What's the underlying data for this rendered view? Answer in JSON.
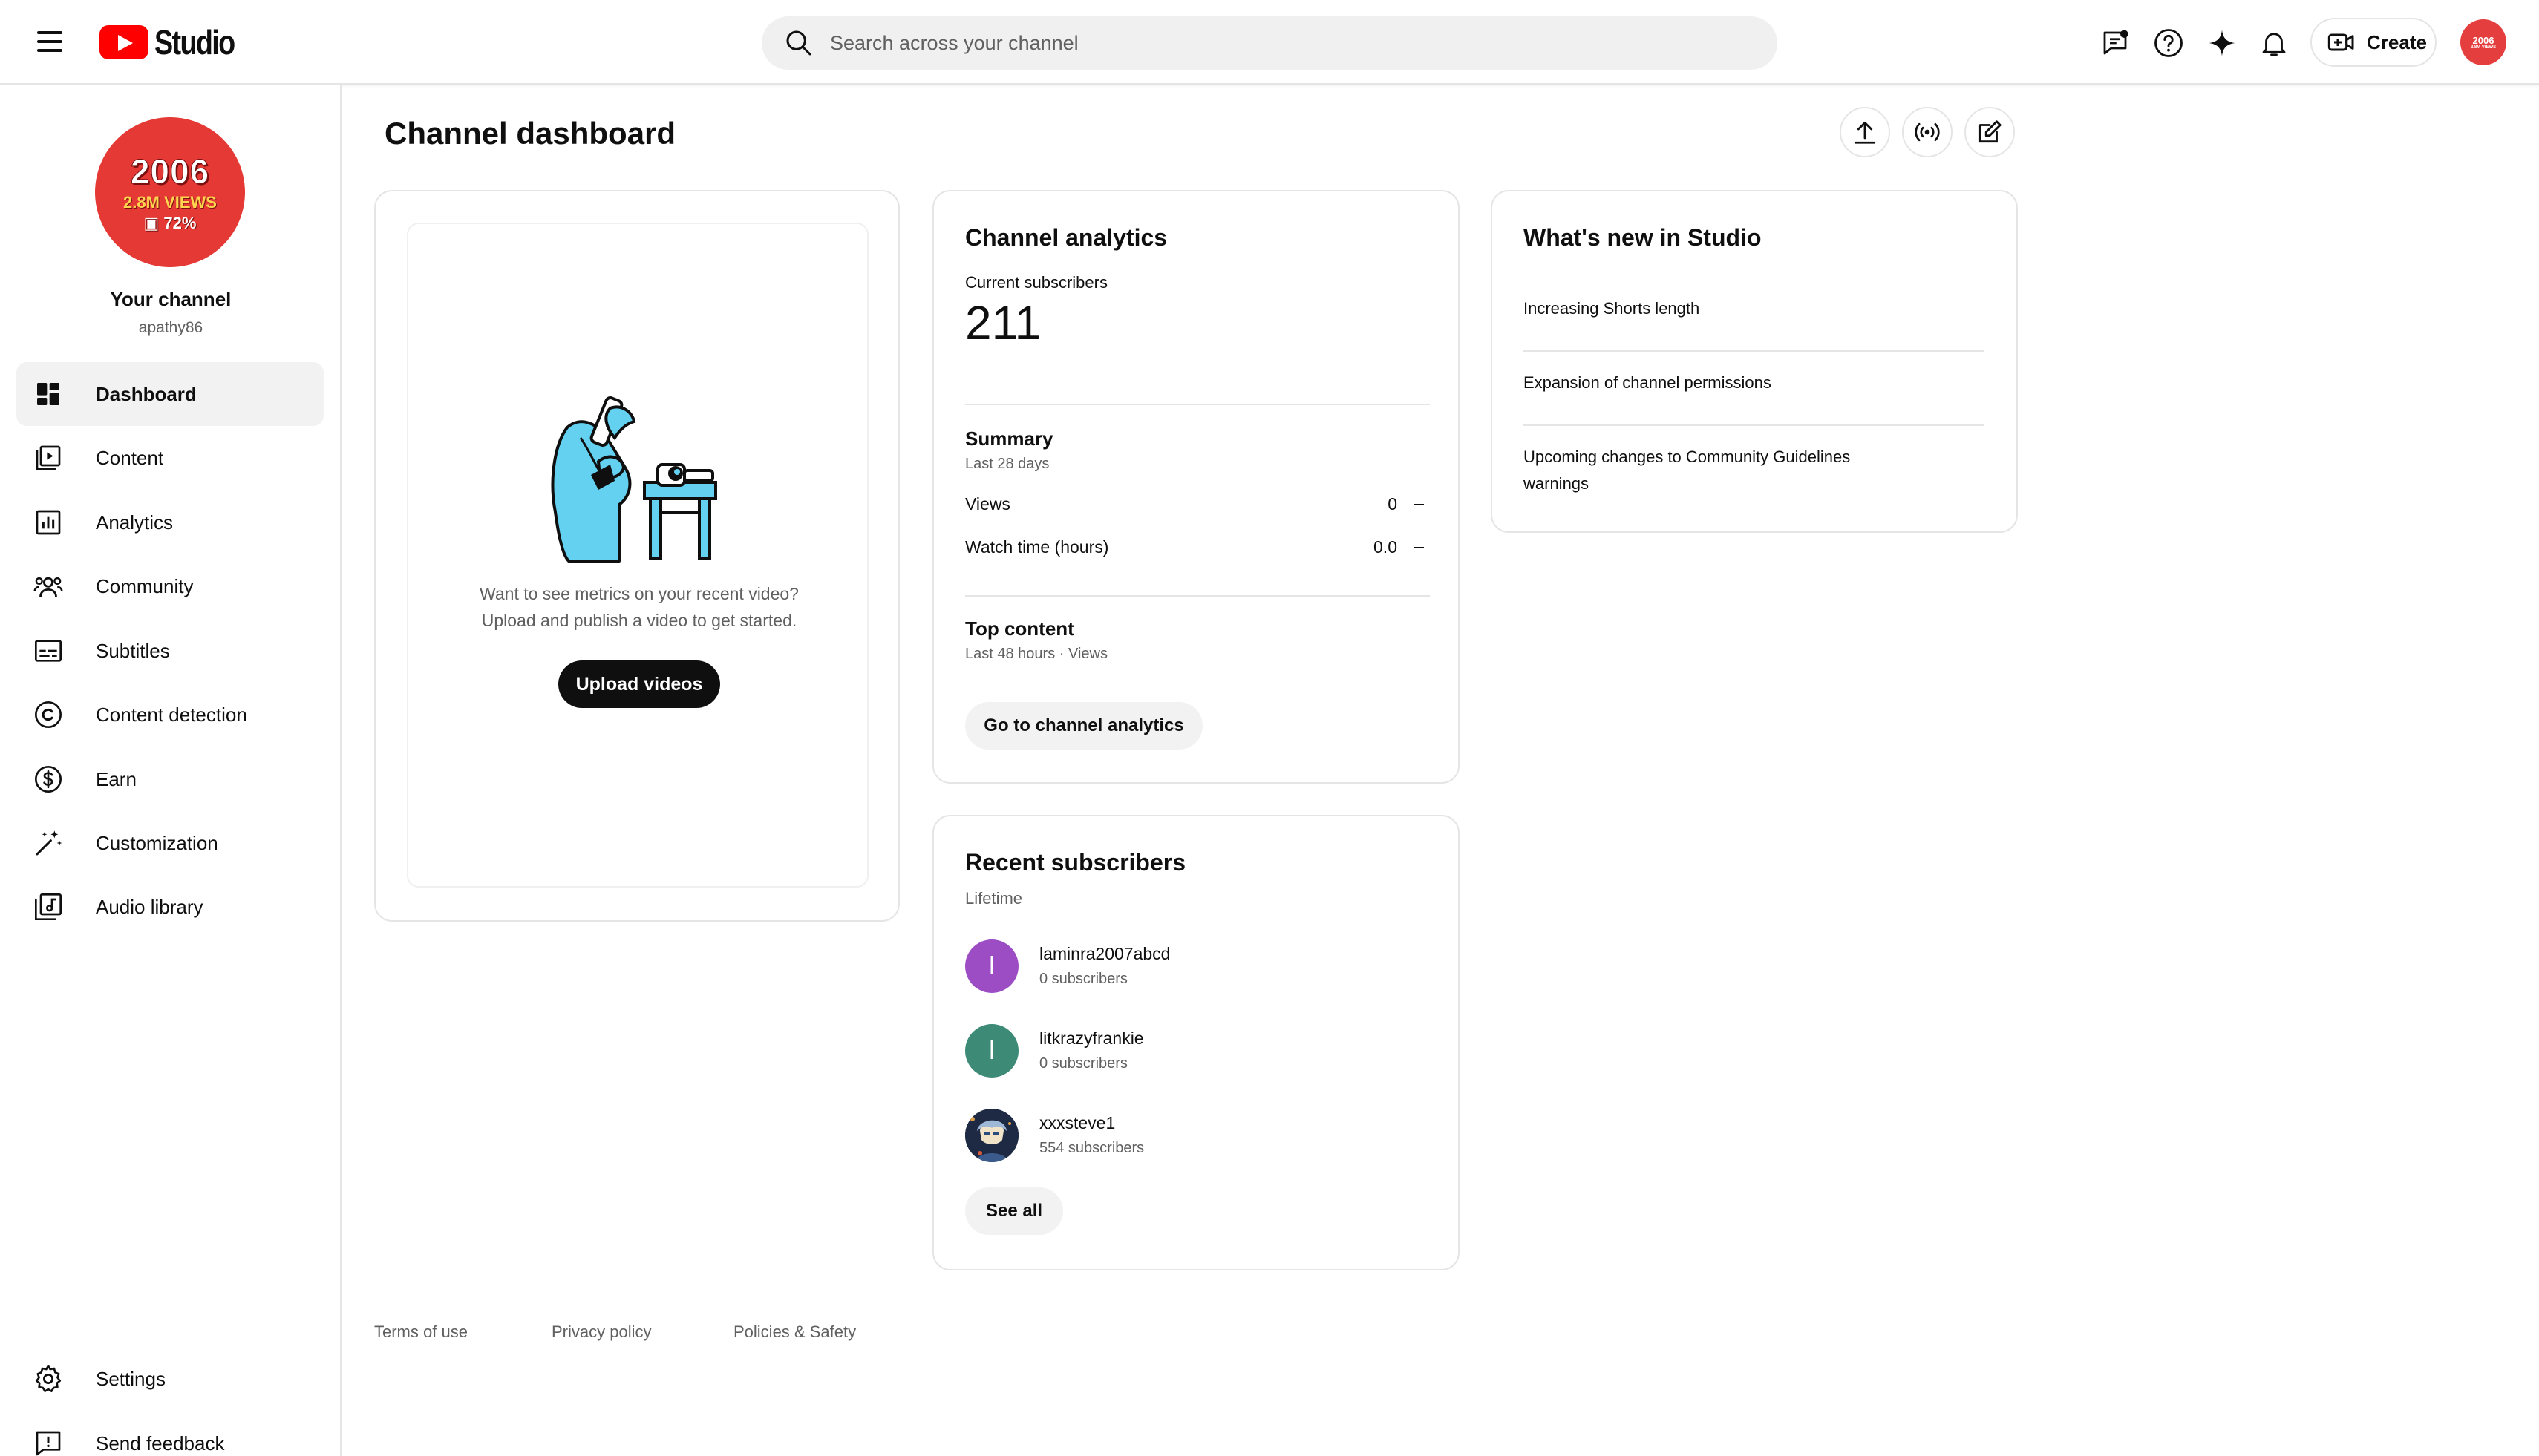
{
  "header": {
    "app_name": "Studio",
    "search_placeholder": "Search across your channel",
    "create_label": "Create",
    "avatar_year": "2006",
    "avatar_sub": "2.8M VIEWS"
  },
  "sidebar": {
    "channel_title": "Your channel",
    "channel_handle": "apathy86",
    "avatar": {
      "year": "2006",
      "views": "2.8M VIEWS",
      "percent": "72%"
    },
    "items": [
      {
        "label": "Dashboard",
        "icon": "dashboard-icon",
        "active": true
      },
      {
        "label": "Content",
        "icon": "content-icon"
      },
      {
        "label": "Analytics",
        "icon": "analytics-icon"
      },
      {
        "label": "Community",
        "icon": "community-icon"
      },
      {
        "label": "Subtitles",
        "icon": "subtitles-icon"
      },
      {
        "label": "Content detection",
        "icon": "copyright-icon"
      },
      {
        "label": "Earn",
        "icon": "dollar-icon"
      },
      {
        "label": "Customization",
        "icon": "magic-wand-icon"
      },
      {
        "label": "Audio library",
        "icon": "audio-library-icon"
      }
    ],
    "bottom_items": [
      {
        "label": "Settings",
        "icon": "gear-icon"
      },
      {
        "label": "Send feedback",
        "icon": "feedback-icon"
      }
    ]
  },
  "main": {
    "title": "Channel dashboard",
    "video_card": {
      "text_line1": "Want to see metrics on your recent video?",
      "text_line2": "Upload and publish a video to get started.",
      "upload_label": "Upload videos"
    },
    "analytics": {
      "title": "Channel analytics",
      "subs_label": "Current subscribers",
      "subs_value": "211",
      "summary_title": "Summary",
      "summary_period": "Last 28 days",
      "rows": [
        {
          "label": "Views",
          "value": "0"
        },
        {
          "label": "Watch time (hours)",
          "value": "0.0"
        }
      ],
      "top_content_title": "Top content",
      "top_content_period": "Last 48 hours · Views",
      "button_label": "Go to channel analytics"
    },
    "recent_subs": {
      "title": "Recent subscribers",
      "period": "Lifetime",
      "subs": [
        {
          "name": "laminra2007abcd",
          "count": "0 subscribers",
          "initial": "l",
          "color": "#9c4dc4"
        },
        {
          "name": "litkrazyfrankie",
          "count": "0 subscribers",
          "initial": "l",
          "color": "#3d8a76"
        },
        {
          "name": "xxxsteve1",
          "count": "554 subscribers",
          "initial": "",
          "color": "#2b3a5c"
        }
      ],
      "see_all_label": "See all"
    },
    "whats_new": {
      "title": "What's new in Studio",
      "items": [
        "Increasing Shorts length",
        "Expansion of channel permissions",
        "Upcoming changes to Community Guidelines warnings"
      ]
    }
  },
  "footer": {
    "links": [
      "Terms of use",
      "Privacy policy",
      "Policies & Safety"
    ]
  },
  "colors": {
    "brand_red": "#ff0000",
    "text": "#0f0f0f",
    "secondary_text": "#606060",
    "border": "#e5e5e5"
  }
}
